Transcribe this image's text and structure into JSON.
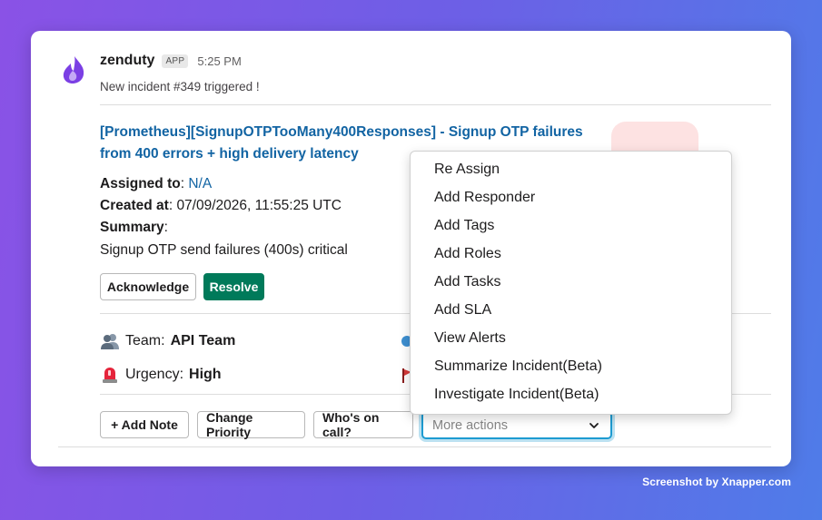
{
  "message": {
    "app_name": "zenduty",
    "app_badge": "APP",
    "time": "5:25 PM",
    "subtitle": "New incident #349 triggered !"
  },
  "incident": {
    "title": "[Prometheus][SignupOTPTooMany400Responses] - Signup OTP failures from 400 errors + high delivery latency",
    "assigned_label": "Assigned to",
    "assigned_value": "N/A",
    "created_label": "Created at",
    "created_value": "07/09/2026, 11:55:25 UTC",
    "summary_label": "Summary",
    "summary_value": "Signup OTP send failures (400s) critical"
  },
  "actions": {
    "acknowledge": "Acknowledge",
    "resolve": "Resolve"
  },
  "details": {
    "team_label": "Team:",
    "team_value": "API Team",
    "urgency_label": "Urgency:",
    "urgency_value": "High"
  },
  "footer_actions": {
    "add_note": "+ Add Note",
    "change_priority": "Change Priority",
    "whos_on_call": "Who's on call?",
    "more_actions_placeholder": "More actions"
  },
  "dropdown": {
    "items": [
      "Re Assign",
      "Add Responder",
      "Add Tags",
      "Add Roles",
      "Add Tasks",
      "Add SLA",
      "View Alerts",
      "Summarize Incident(Beta)",
      "Investigate Incident(Beta)"
    ]
  },
  "watermark": "Screenshot by Xnapper.com",
  "colors": {
    "link": "#1264a3",
    "resolve": "#007a5a",
    "focus": "#1d9bd1"
  }
}
